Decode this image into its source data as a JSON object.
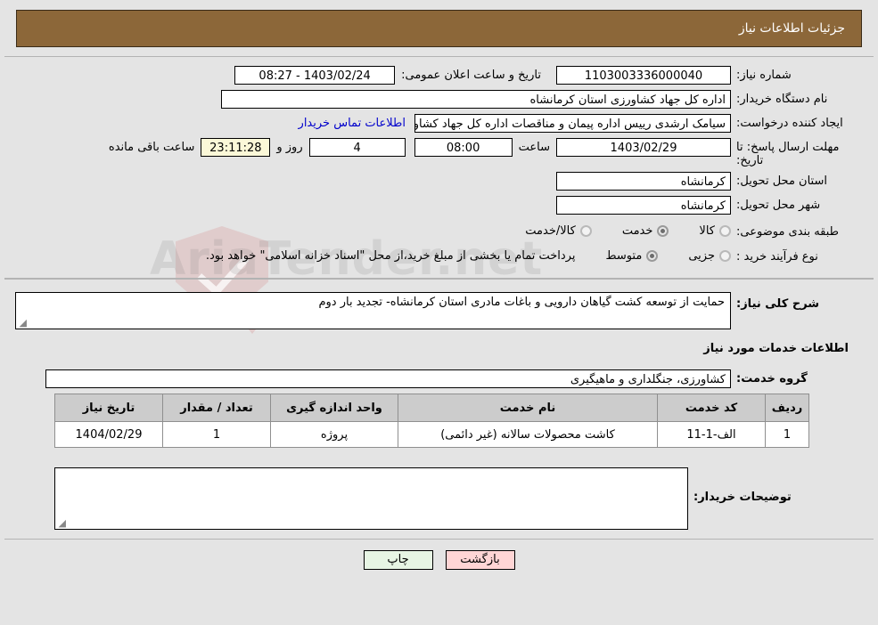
{
  "header": {
    "title": "جزئیات اطلاعات نیاز"
  },
  "form": {
    "need_number": {
      "label": "شماره نیاز:",
      "value": "1103003336000040"
    },
    "announce": {
      "label": "تاریخ و ساعت اعلان عمومی:",
      "value": "1403/02/24 - 08:27"
    },
    "buyer_org": {
      "label": "نام دستگاه خریدار:",
      "value": "اداره کل جهاد کشاورزی استان کرمانشاه"
    },
    "creator": {
      "label": "ایجاد کننده درخواست:",
      "value": "سیامک ارشدی رییس اداره پیمان و مناقصات اداره کل جهاد کشاورزی استان کرمانشاه",
      "contact_link": "اطلاعات تماس خریدار"
    },
    "deadline": {
      "label": "مهلت ارسال پاسخ: تا تاریخ:",
      "date": "1403/02/29",
      "time_label": "ساعت",
      "time": "08:00",
      "days": "4",
      "days_label": "روز و",
      "countdown": "23:11:28",
      "countdown_label": "ساعت باقی مانده"
    },
    "province": {
      "label": "استان محل تحویل:",
      "value": "کرمانشاه"
    },
    "city": {
      "label": "شهر محل تحویل:",
      "value": "کرمانشاه"
    },
    "category": {
      "label": "طبقه بندی موضوعی:",
      "options": [
        {
          "label": "کالا",
          "selected": false
        },
        {
          "label": "خدمت",
          "selected": true
        },
        {
          "label": "کالا/خدمت",
          "selected": false
        }
      ]
    },
    "purchase_type": {
      "label": "نوع فرآیند خرید :",
      "options": [
        {
          "label": "جزیی",
          "selected": false
        },
        {
          "label": "متوسط",
          "selected": true
        }
      ],
      "note": "پرداخت تمام یا بخشی از مبلغ خرید،از محل \"اسناد خزانه اسلامی\" خواهد بود."
    }
  },
  "summary": {
    "label": "شرح کلی نیاز:",
    "value": "حمایت از توسعه کشت گیاهان دارویی و باغات مادری استان کرمانشاه- تجدید بار دوم"
  },
  "services_section": {
    "heading": "اطلاعات خدمات مورد نیاز",
    "group_label": "گروه خدمت:",
    "group_value": "کشاورزی، جنگلداری و ماهیگیری"
  },
  "table": {
    "headers": [
      "ردیف",
      "کد خدمت",
      "نام خدمت",
      "واحد اندازه گیری",
      "تعداد / مقدار",
      "تاریخ نیاز"
    ],
    "rows": [
      {
        "row_no": "1",
        "service_code": "الف-1-11",
        "service_name": "کاشت محصولات سالانه (غیر دائمی)",
        "unit": "پروژه",
        "quantity": "1",
        "need_date": "1404/02/29"
      }
    ]
  },
  "buyer_notes": {
    "label": "توضیحات خریدار:",
    "value": ""
  },
  "footer": {
    "back_label": "بازگشت",
    "print_label": "چاپ"
  },
  "watermark": {
    "text": "AriaTender.net"
  }
}
